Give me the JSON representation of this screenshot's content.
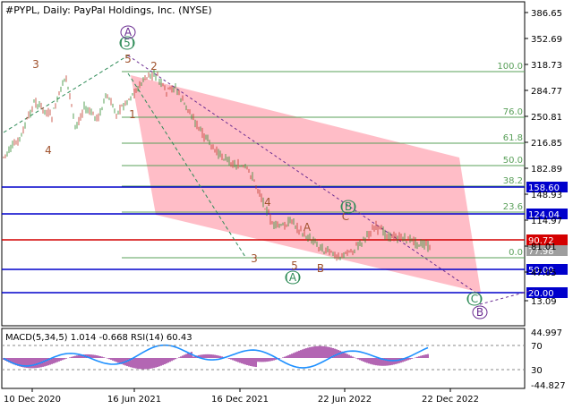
{
  "header": {
    "title": "#PYPL, Daily:  PayPal Holdings, Inc. (NYSE)"
  },
  "colors": {
    "bull_candle": "#2e8b2e",
    "bear_candle": "#c0392b",
    "wave_labels": "#a0522d",
    "wave_green": "#2e8b57",
    "wave_purple": "#6a2c91",
    "fib_lines": "#5aa05a",
    "support_lines": "#0000cc",
    "current_level": "#d40000",
    "channel_fill": "#ffb6c1",
    "macd_hist": "#800080",
    "rsi_line": "#1e90ff"
  },
  "chart_data": [
    {
      "type": "line",
      "y_axis": {
        "scale": "log",
        "ylim": [
          13.69,
          386.65
        ],
        "tick_labels": [
          "386.65",
          "352.69",
          "318.73",
          "284.77",
          "250.81",
          "216.85",
          "182.89",
          "148.93",
          "114.97",
          "81.01",
          "47.05",
          "13.09"
        ]
      },
      "x_axis": {
        "tick_labels": [
          "10 Dec 2020",
          "16 Jun 2021",
          "16 Dec 2021",
          "22 Jun 2022",
          "22 Dec 2022"
        ]
      },
      "series": [
        {
          "name": "",
          "x": [
            "2020-10-01",
            "2020-11-10",
            "2020-12-15",
            "2021-01-15",
            "2021-02-10",
            "2021-02-28",
            "2021-03-15",
            "2021-04-10",
            "2021-04-25",
            "2021-05-15",
            "2021-06-01",
            "2021-06-20",
            "2021-07-05",
            "2021-07-24",
            "2021-08-10",
            "2021-08-25",
            "2021-09-10",
            "2021-09-25",
            "2021-10-08",
            "2021-10-20",
            "2021-11-03",
            "2021-11-18",
            "2021-12-01",
            "2021-12-15",
            "2022-01-01",
            "2022-01-20",
            "2022-02-02",
            "2022-02-12",
            "2022-03-01",
            "2022-03-20",
            "2022-04-10",
            "2022-04-28",
            "2022-05-12",
            "2022-05-25",
            "2022-06-10",
            "2022-06-22",
            "2022-07-10",
            "2022-07-25",
            "2022-08-05",
            "2022-08-15",
            "2022-09-05",
            "2022-09-25",
            "2022-10-10",
            "2022-10-25",
            "2022-11-08",
            "2022-11-25",
            "2022-12-10"
          ],
          "y": [
            195,
            220,
            270,
            250,
            305,
            235,
            262,
            248,
            278,
            255,
            270,
            286,
            300,
            305,
            282,
            290,
            268,
            250,
            232,
            220,
            205,
            198,
            190,
            185,
            180,
            152,
            128,
            110,
            106,
            115,
            95,
            88,
            78,
            72,
            68,
            70,
            78,
            90,
            100,
            106,
            95,
            92,
            90,
            86,
            82,
            78,
            77
          ]
        }
      ],
      "horizontal_levels": [
        {
          "label": "158.60",
          "kind": "support"
        },
        {
          "label": "124.04",
          "kind": "support"
        },
        {
          "label": "90.72",
          "kind": "current"
        },
        {
          "label": "50.00",
          "kind": "support"
        },
        {
          "label": "20.00",
          "kind": "support"
        }
      ],
      "current_price_label": "77.98",
      "fibonacci": [
        {
          "label": "100.0"
        },
        {
          "label": "76.0"
        },
        {
          "label": "61.8"
        },
        {
          "label": "50.0"
        },
        {
          "label": "38.2"
        },
        {
          "label": "23.6"
        },
        {
          "label": "0.0"
        }
      ],
      "wave_labels": [
        "3",
        "4",
        "5",
        "1",
        "2",
        "3",
        "4",
        "5",
        "A",
        "B",
        "C",
        "(A)",
        "(B)",
        "(C)",
        "(5)",
        "A",
        "B"
      ]
    },
    {
      "type": "line",
      "title": "MACD(5,34,5) 1.014 -0.668 RSI(14) 60.43",
      "y_axis": {
        "tick_labels": [
          "44.997",
          "70",
          "30",
          "-44.827"
        ]
      },
      "series": [
        {
          "name": "",
          "kind": "histogram"
        },
        {
          "name": "",
          "kind": "line"
        }
      ]
    }
  ]
}
